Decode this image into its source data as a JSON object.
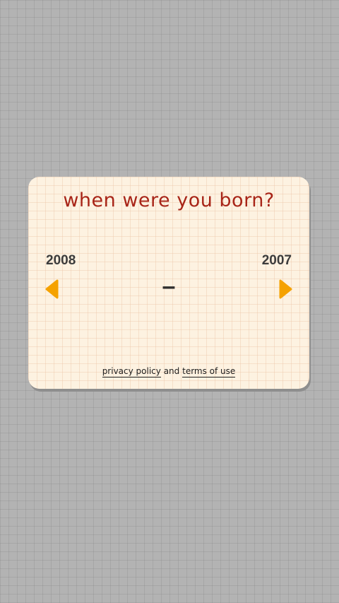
{
  "dialog": {
    "title": "when were you born?",
    "prev_year": "2008",
    "next_year": "2007",
    "current_year": "–",
    "footer": {
      "privacy_label": "privacy policy",
      "connector": "and",
      "terms_label": "terms of use"
    }
  },
  "colors": {
    "title": "#a82518",
    "arrow": "#f5a200",
    "card": "#fdf2e1"
  },
  "icons": {
    "prev": "triangle-left-icon",
    "next": "triangle-right-icon"
  }
}
